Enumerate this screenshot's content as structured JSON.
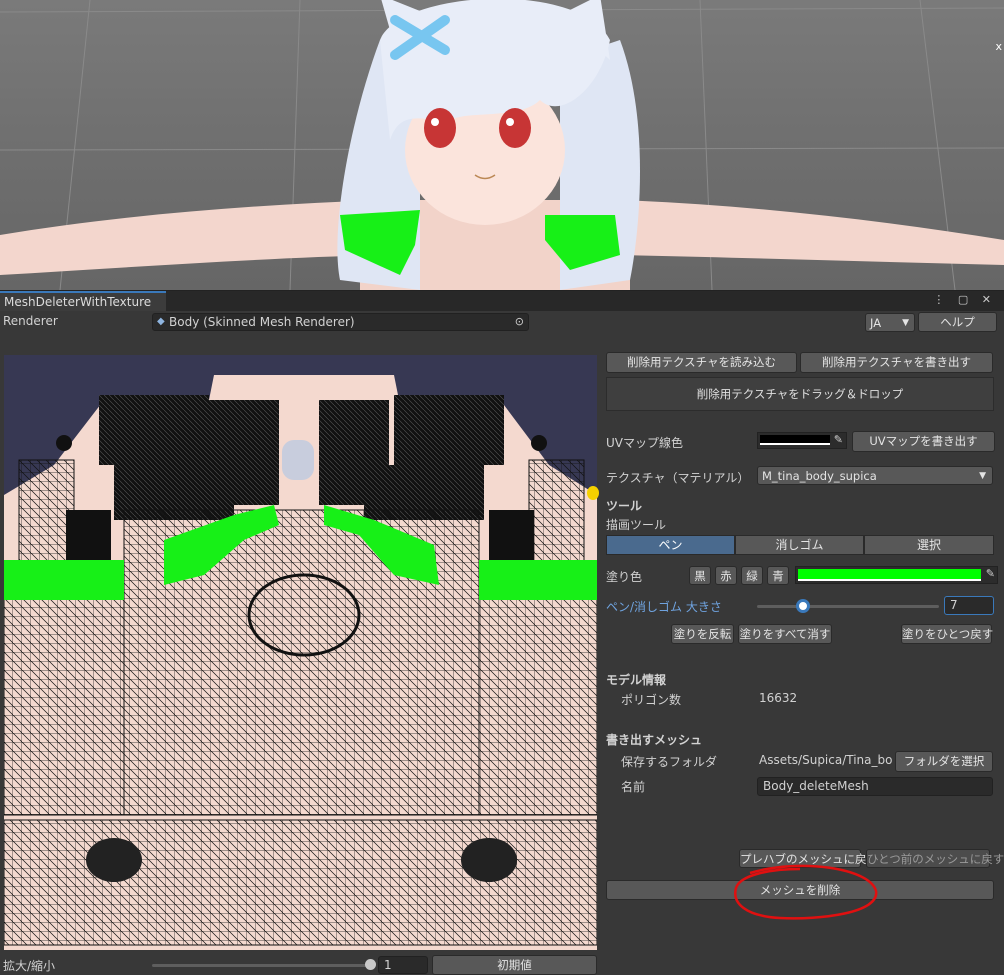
{
  "scene": {
    "close_glyph": "x"
  },
  "window": {
    "tab_title": "MeshDeleterWithTexture",
    "tab_icons": "⋮ ▢ ✕"
  },
  "renderer": {
    "label": "Renderer",
    "value": "Body (Skinned Mesh Renderer)",
    "language": "JA",
    "help": "ヘルプ"
  },
  "delete_texture": {
    "load_label": "削除用テクスチャを読み込む",
    "save_label": "削除用テクスチャを書き出す",
    "drop_label": "削除用テクスチャをドラッグ＆ドロップ"
  },
  "uvmap": {
    "line_color_label": "UVマップ線色",
    "line_color": "#000000",
    "export_label": "UVマップを書き出す"
  },
  "texture": {
    "label": "テクスチャ（マテリアル）",
    "value": "M_tina_body_supica"
  },
  "tools": {
    "header": "ツール",
    "draw_tool_label": "描画ツール",
    "modes": [
      "ペン",
      "消しゴム",
      "選択"
    ],
    "active_mode": 0,
    "paint_color_label": "塗り色",
    "color_presets": [
      "黒",
      "赤",
      "緑",
      "青"
    ],
    "paint_color": "#00ff00",
    "size_label": "ペン/消しゴム 大きさ",
    "size_value": "7",
    "size_fraction": 0.25,
    "invert_label": "塗りを反転",
    "clear_label": "塗りをすべて消す",
    "undo_label": "塗りをひとつ戻す"
  },
  "model_info": {
    "header": "モデル情報",
    "polygon_label": "ポリゴン数",
    "polygon_count": "16632"
  },
  "export_mesh": {
    "header": "書き出すメッシュ",
    "folder_label": "保存するフォルダ",
    "folder_value": "Assets/Supica/Tina_bo",
    "select_folder": "フォルダを選択",
    "name_label": "名前",
    "name_value": "Body_deleteMesh"
  },
  "actions": {
    "revert_prefab": "プレハブのメッシュに戻す",
    "revert_previous": "ひとつ前のメッシュに戻す",
    "delete_mesh": "メッシュを削除"
  },
  "zoom": {
    "label": "拡大/縮小",
    "value": "1",
    "fraction": 1.0,
    "reset": "初期値"
  },
  "colors": {
    "accent": "#3a79bb",
    "annotation": "#e01010",
    "paint": "#00ff00"
  }
}
